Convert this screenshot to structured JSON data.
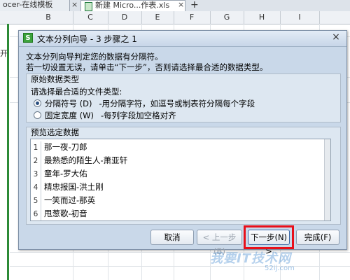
{
  "tabs": {
    "tab1_label": "ocer-在线模板",
    "tab2_label": "新建 Micro...作表.xls",
    "close_glyph": "×",
    "plus_glyph": "+"
  },
  "columns": [
    "B",
    "C",
    "D",
    "E",
    "F",
    "G",
    "H",
    "I"
  ],
  "left_cell_text": "开",
  "dialog": {
    "icon_letter": "S",
    "title": "文本分列向导 - 3 步骤之 1",
    "close_glyph": "×",
    "desc_line1": "文本分列向导判定您的数据有分隔符。",
    "desc_line2": "若一切设置无误，请单击“下一步”，否则请选择最合适的数据类型。",
    "original_type_section": {
      "title": "原始数据类型",
      "prompt": "请选择最合适的文件类型:",
      "options": [
        {
          "label": "分隔符号 (D)",
          "desc": "-用分隔字符，如逗号或制表符分隔每个字段",
          "checked": true
        },
        {
          "label": "固定宽度 (W)",
          "desc": "-每列字段加空格对齐",
          "checked": false
        }
      ]
    },
    "preview_section": {
      "title": "预览选定数据",
      "rows": [
        {
          "num": "1",
          "text": "那一夜-刀郎"
        },
        {
          "num": "2",
          "text": "最熟悉的陌生人-萧亚轩"
        },
        {
          "num": "3",
          "text": "童年-罗大佑"
        },
        {
          "num": "4",
          "text": "精忠报国-洪土刚"
        },
        {
          "num": "5",
          "text": "一笑而过-那英"
        },
        {
          "num": "6",
          "text": "甩葱歌-初音"
        }
      ]
    },
    "buttons": {
      "cancel": "取消",
      "back": "< 上一步(B)",
      "next": "下一步(N) >",
      "finish": "完成(F)"
    }
  },
  "watermark": {
    "text": "我要IT技术网",
    "url": "52ij.com"
  },
  "colors": {
    "highlight": "#e8101a",
    "dialog_bg": "#c9d8e9",
    "sheet_green": "#2c8a36"
  }
}
